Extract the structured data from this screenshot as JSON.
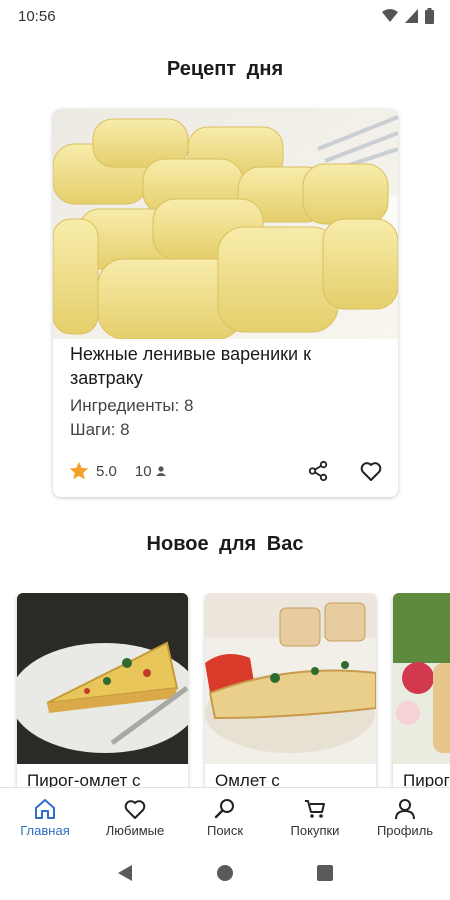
{
  "status": {
    "time": "10:56"
  },
  "titles": {
    "recipe_of_day": "Рецепт  дня",
    "new_for_you": "Новое  для  Вас"
  },
  "featured": {
    "name": "Нежные ленивые вареники к завтраку",
    "ingredients": "Ингредиенты: 8",
    "steps": "Шаги: 8",
    "rating": "5.0",
    "reviews": "10"
  },
  "new_recipes": [
    {
      "name": "Пирог-омлет с"
    },
    {
      "name": "Омлет с"
    },
    {
      "name": "Пирог"
    }
  ],
  "nav": [
    {
      "label": "Главная",
      "icon": "home-icon"
    },
    {
      "label": "Любимые",
      "icon": "heart-icon"
    },
    {
      "label": "Поиск",
      "icon": "search-icon"
    },
    {
      "label": "Покупки",
      "icon": "cart-icon"
    },
    {
      "label": "Профиль",
      "icon": "profile-icon"
    }
  ],
  "colors": {
    "accent": "#2f6fc6",
    "star": "#f4a12b"
  }
}
